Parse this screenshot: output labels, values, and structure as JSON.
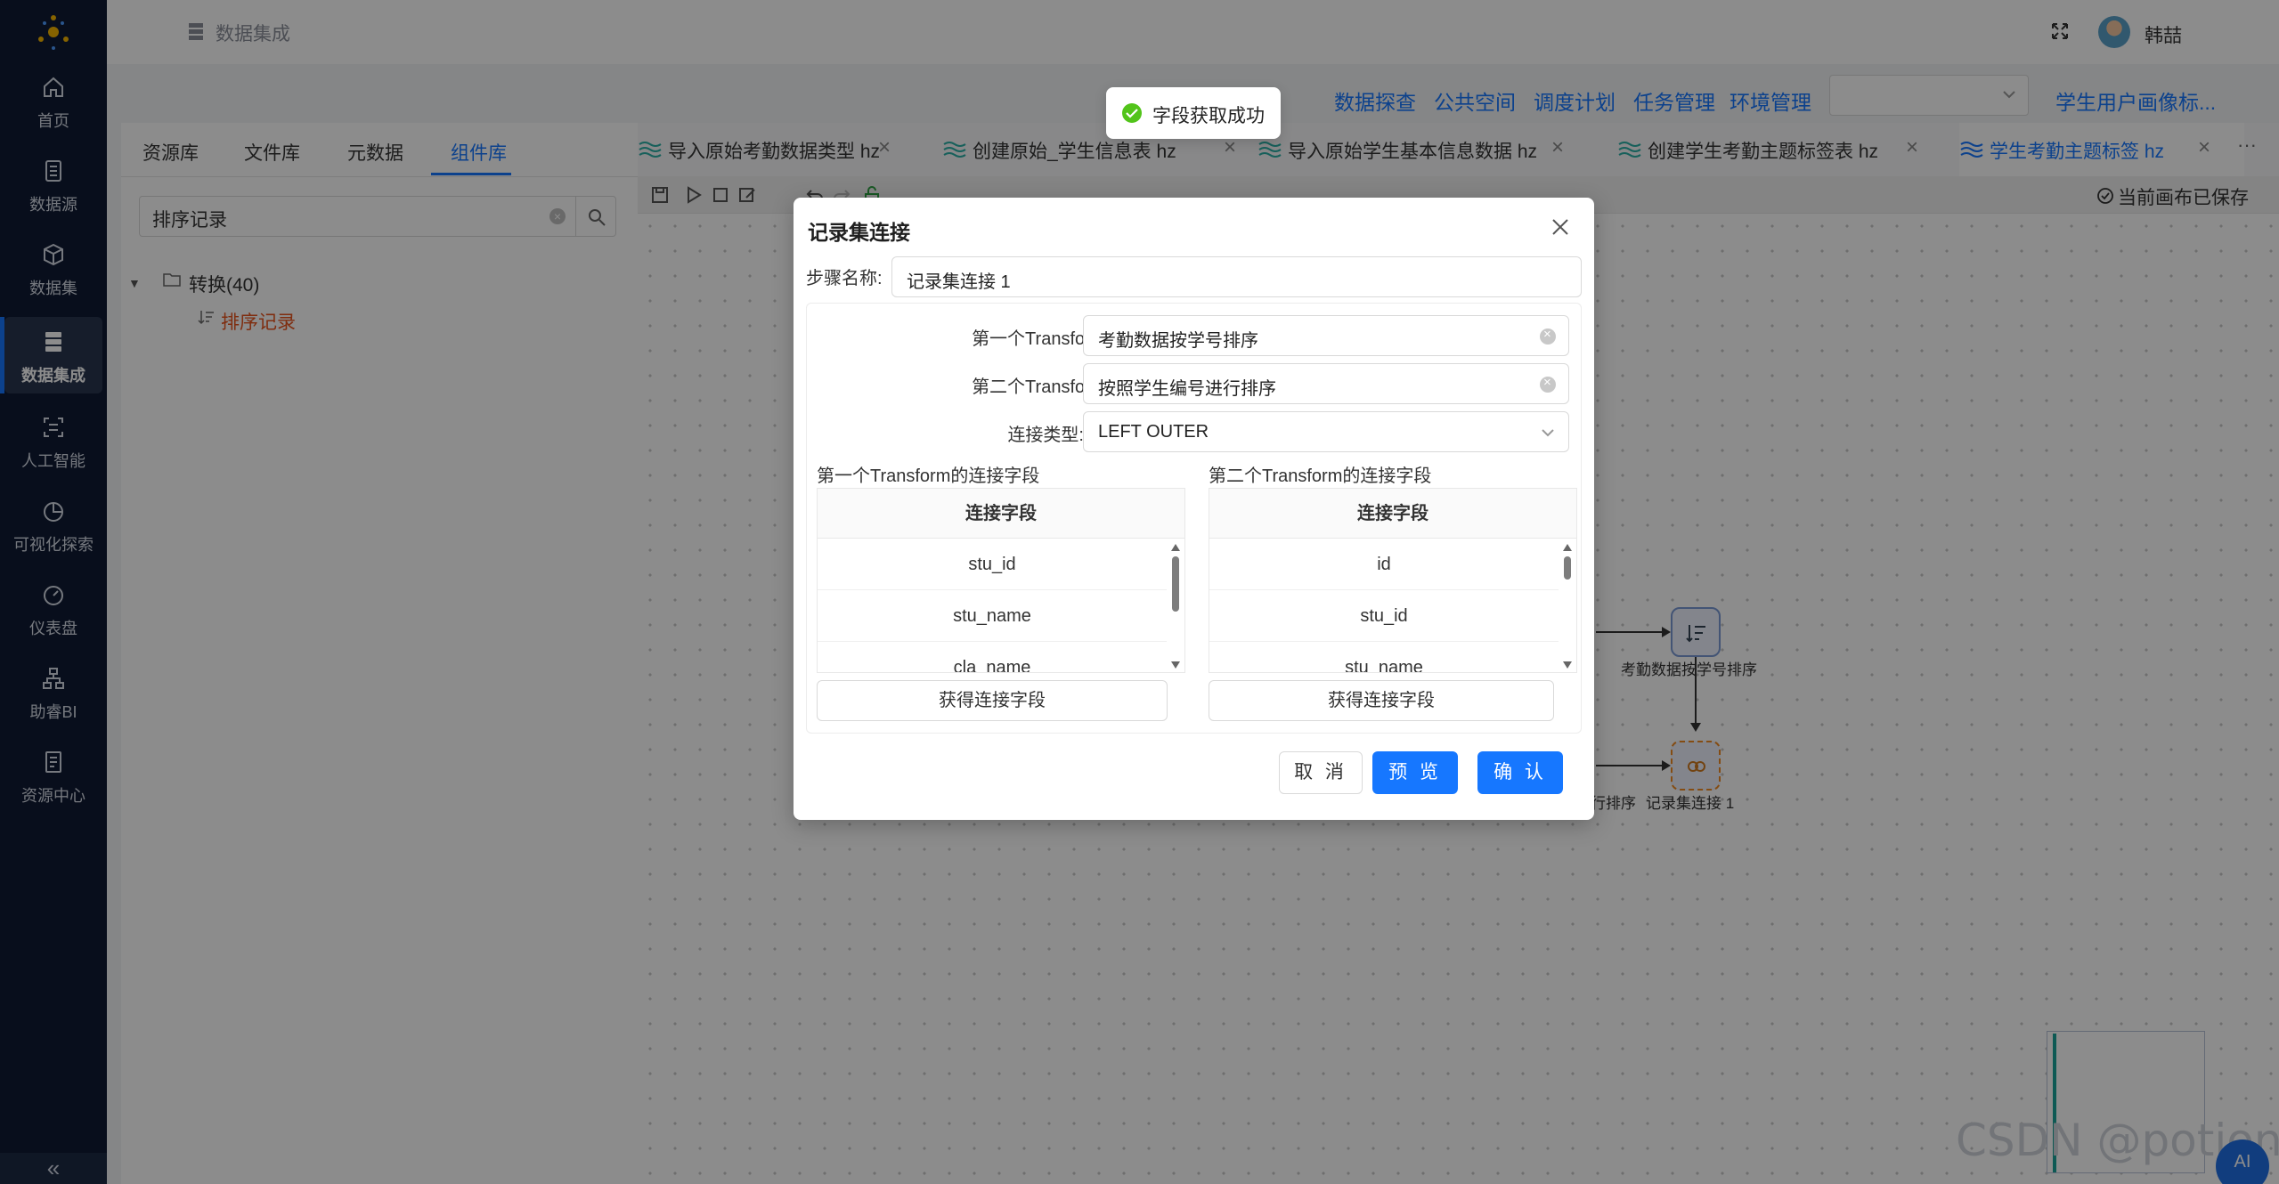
{
  "sidebar": {
    "items": [
      {
        "label": "首页",
        "icon": "home-icon"
      },
      {
        "label": "数据源",
        "icon": "database-icon"
      },
      {
        "label": "数据集",
        "icon": "cube-icon"
      },
      {
        "label": "数据集成",
        "icon": "server-icon"
      },
      {
        "label": "人工智能",
        "icon": "ai-scan-icon"
      },
      {
        "label": "可视化探索",
        "icon": "pie-chart-icon"
      },
      {
        "label": "仪表盘",
        "icon": "dashboard-gauge-icon"
      },
      {
        "label": "助睿BI",
        "icon": "org-tree-icon"
      },
      {
        "label": "资源中心",
        "icon": "document-icon"
      }
    ],
    "active_index": 3,
    "collapse_glyph": "«"
  },
  "header": {
    "breadcrumb": "数据集成",
    "user_name": "韩喆"
  },
  "top_links": [
    "数据探查",
    "公共空间",
    "调度计划",
    "任务管理",
    "环境管理"
  ],
  "env_select": {
    "value": ""
  },
  "portrait_link": "学生用户画像标...",
  "left_panel": {
    "tabs": [
      "资源库",
      "文件库",
      "元数据",
      "组件库"
    ],
    "active_tab": 3,
    "search_value": "排序记录",
    "tree": {
      "folder": "转换(40)",
      "leaf": "排序记录"
    }
  },
  "tabs": [
    {
      "label": "导入原始考勤数据类型 hz"
    },
    {
      "label": "创建原始_学生信息表 hz"
    },
    {
      "label": "导入原始学生基本信息数据 hz"
    },
    {
      "label": "创建学生考勤主题标签表 hz"
    },
    {
      "label": "学生考勤主题标签 hz",
      "active": true
    }
  ],
  "tabs_more": "···",
  "toolbar": {
    "saved_text": "当前画布已保存"
  },
  "canvas": {
    "node1_label": "考勤数据按学号排序",
    "node2_label": "记录集连接 1",
    "partial_label": "行排序"
  },
  "toast": {
    "message": "字段获取成功"
  },
  "dialog": {
    "title": "记录集连接",
    "step_name_label": "步骤名称:",
    "step_name_value": "记录集连接 1",
    "first_transform_label": "第一个Transform:",
    "first_transform_value": "考勤数据按学号排序",
    "second_transform_label": "第二个Transform:",
    "second_transform_value": "按照学生编号进行排序",
    "join_type_label": "连接类型:",
    "join_type_value": "LEFT OUTER",
    "left_fields_title": "第一个Transform的连接字段",
    "right_fields_title": "第二个Transform的连接字段",
    "grid_header": "连接字段",
    "left_fields": [
      "stu_id",
      "stu_name",
      "cla_name"
    ],
    "right_fields": [
      "id",
      "stu_id",
      "stu_name"
    ],
    "get_fields_button": "获得连接字段",
    "cancel_button": "取 消",
    "preview_button": "预 览",
    "confirm_button": "确 认"
  },
  "watermark": "CSDN @potion()",
  "ai_badge": "AI"
}
